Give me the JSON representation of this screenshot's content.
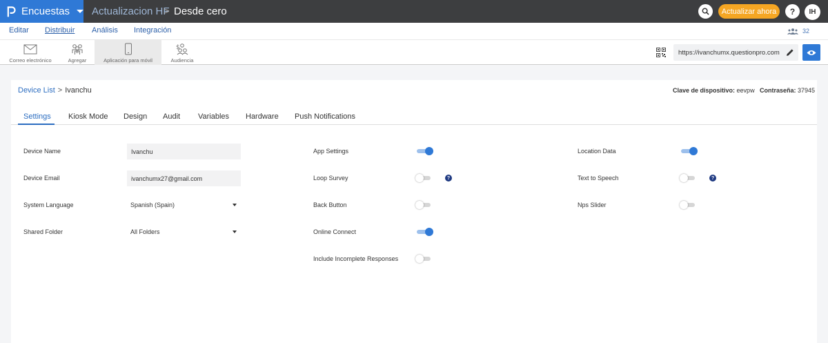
{
  "topbar": {
    "brand": "Encuestas",
    "crumb_parent": "Actualizacion HF",
    "crumb_sep": ">",
    "crumb_current": "Desde cero",
    "update_label": "Actualizar ahora",
    "help_label": "?",
    "user_initials": "IH"
  },
  "menu": {
    "items": [
      "Editar",
      "Distribuir",
      "Análisis",
      "Integración"
    ],
    "active": "Distribuir",
    "users_count": "32"
  },
  "toolbar": {
    "tools": [
      "Correo electrónico",
      "Agregar",
      "Aplicación para móvil",
      "Audiencia"
    ],
    "active": "Aplicación para móvil",
    "url": "https://ivanchumx.questionpro.com"
  },
  "breadcrumb": {
    "parent": "Device List",
    "sep": ">",
    "current": "Ivanchu"
  },
  "device_meta": {
    "key_label": "Clave de dispositivo:",
    "key_value": "eevpw",
    "password_label": "Contraseña:",
    "password_value": "37945"
  },
  "tabs": [
    "Settings",
    "Kiosk Mode",
    "Design",
    "Audit",
    "Variables",
    "Hardware",
    "Push Notifications"
  ],
  "active_tab": "Settings",
  "form": {
    "device_name_label": "Device Name",
    "device_name_value": "Ivanchu",
    "device_email_label": "Device Email",
    "device_email_value": "ivanchumx27@gmail.com",
    "system_language_label": "System Language",
    "system_language_value": "Spanish (Spain)",
    "shared_folder_label": "Shared Folder",
    "shared_folder_value": "All Folders"
  },
  "toggles_mid": [
    {
      "label": "App Settings",
      "on": true,
      "help": false
    },
    {
      "label": "Loop Survey",
      "on": false,
      "help": true
    },
    {
      "label": "Back Button",
      "on": false,
      "help": false
    },
    {
      "label": "Online Connect",
      "on": true,
      "help": false
    },
    {
      "label": "Include Incomplete Responses",
      "on": false,
      "help": false
    }
  ],
  "toggles_right": [
    {
      "label": "Location Data",
      "on": true,
      "help": false
    },
    {
      "label": "Text to Speech",
      "on": false,
      "help": true
    },
    {
      "label": "Nps Slider",
      "on": false,
      "help": false
    }
  ],
  "colors": {
    "primary": "#2f79d6",
    "topbar": "#3d3e40",
    "update_button": "#f5a623",
    "help_badge": "#1f3a82"
  }
}
